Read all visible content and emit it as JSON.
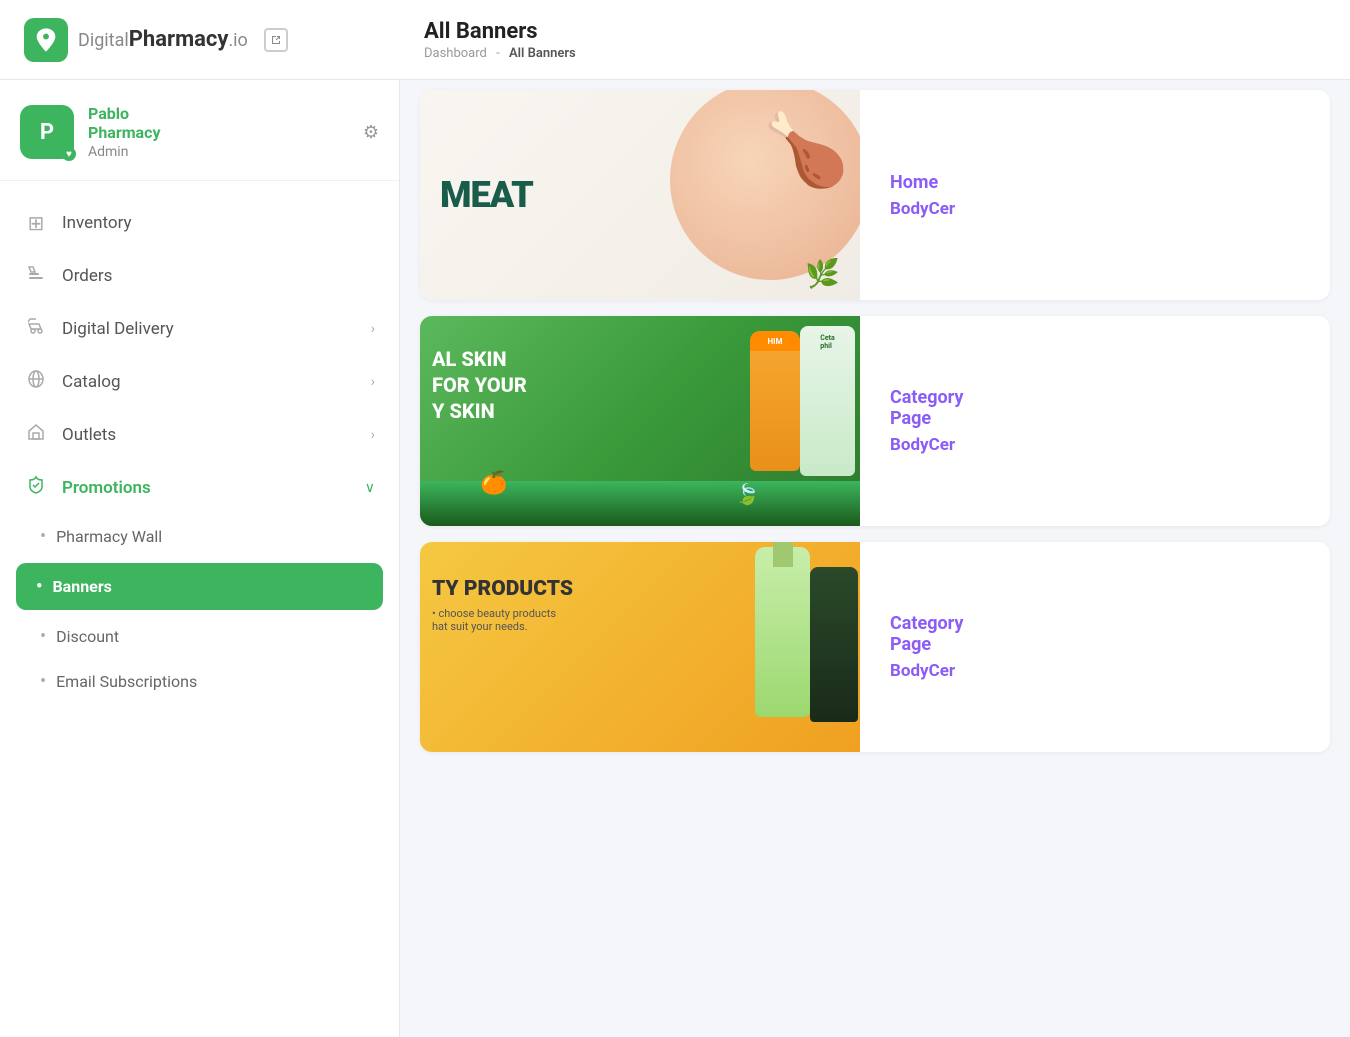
{
  "header": {
    "logo_text_regular": "Digital",
    "logo_text_bold": "Pharmacy",
    "logo_suffix": ".io",
    "page_title": "All Banners",
    "breadcrumb_home": "Dashboard",
    "breadcrumb_separator": "-",
    "breadcrumb_current": "All Banners"
  },
  "user": {
    "initial": "P",
    "name_line1": "Pablo",
    "name_line2": "Pharmacy",
    "role": "Admin"
  },
  "nav": {
    "items": [
      {
        "id": "inventory",
        "label": "Inventory",
        "icon": "⊞",
        "has_chevron": false
      },
      {
        "id": "orders",
        "label": "Orders",
        "icon": "📋",
        "has_chevron": false
      },
      {
        "id": "digital-delivery",
        "label": "Digital Delivery",
        "icon": "🚲",
        "has_chevron": true
      },
      {
        "id": "catalog",
        "label": "Catalog",
        "icon": "🏷",
        "has_chevron": true
      },
      {
        "id": "outlets",
        "label": "Outlets",
        "icon": "🏛",
        "has_chevron": true
      },
      {
        "id": "promotions",
        "label": "Promotions",
        "icon": "📡",
        "has_chevron": false,
        "active": true
      }
    ],
    "sub_items": [
      {
        "id": "pharmacy-wall",
        "label": "Pharmacy Wall",
        "active": false
      },
      {
        "id": "banners",
        "label": "Banners",
        "active": true
      },
      {
        "id": "discount",
        "label": "Discount",
        "active": false
      },
      {
        "id": "email-subscriptions",
        "label": "Email Subscriptions",
        "active": false
      }
    ]
  },
  "banners": [
    {
      "id": "meat-banner",
      "type": "meat",
      "text": "MEAT",
      "page_type": "Home",
      "category": "BodyCer"
    },
    {
      "id": "skin-banner",
      "type": "skin",
      "text_line1": "AL SKIN",
      "text_line2": "FOR YOUR",
      "text_line3": "Y SKIN",
      "page_type": "Category",
      "page_type_line2": "Page",
      "category": "BodyCer"
    },
    {
      "id": "beauty-banner",
      "type": "beauty",
      "text_title": "TY PRODUCTS",
      "text_subtitle1": "• choose beauty products",
      "text_subtitle2": "hat suit your needs.",
      "page_type": "Category",
      "page_type_line2": "Page",
      "category": "BodyCer"
    }
  ]
}
